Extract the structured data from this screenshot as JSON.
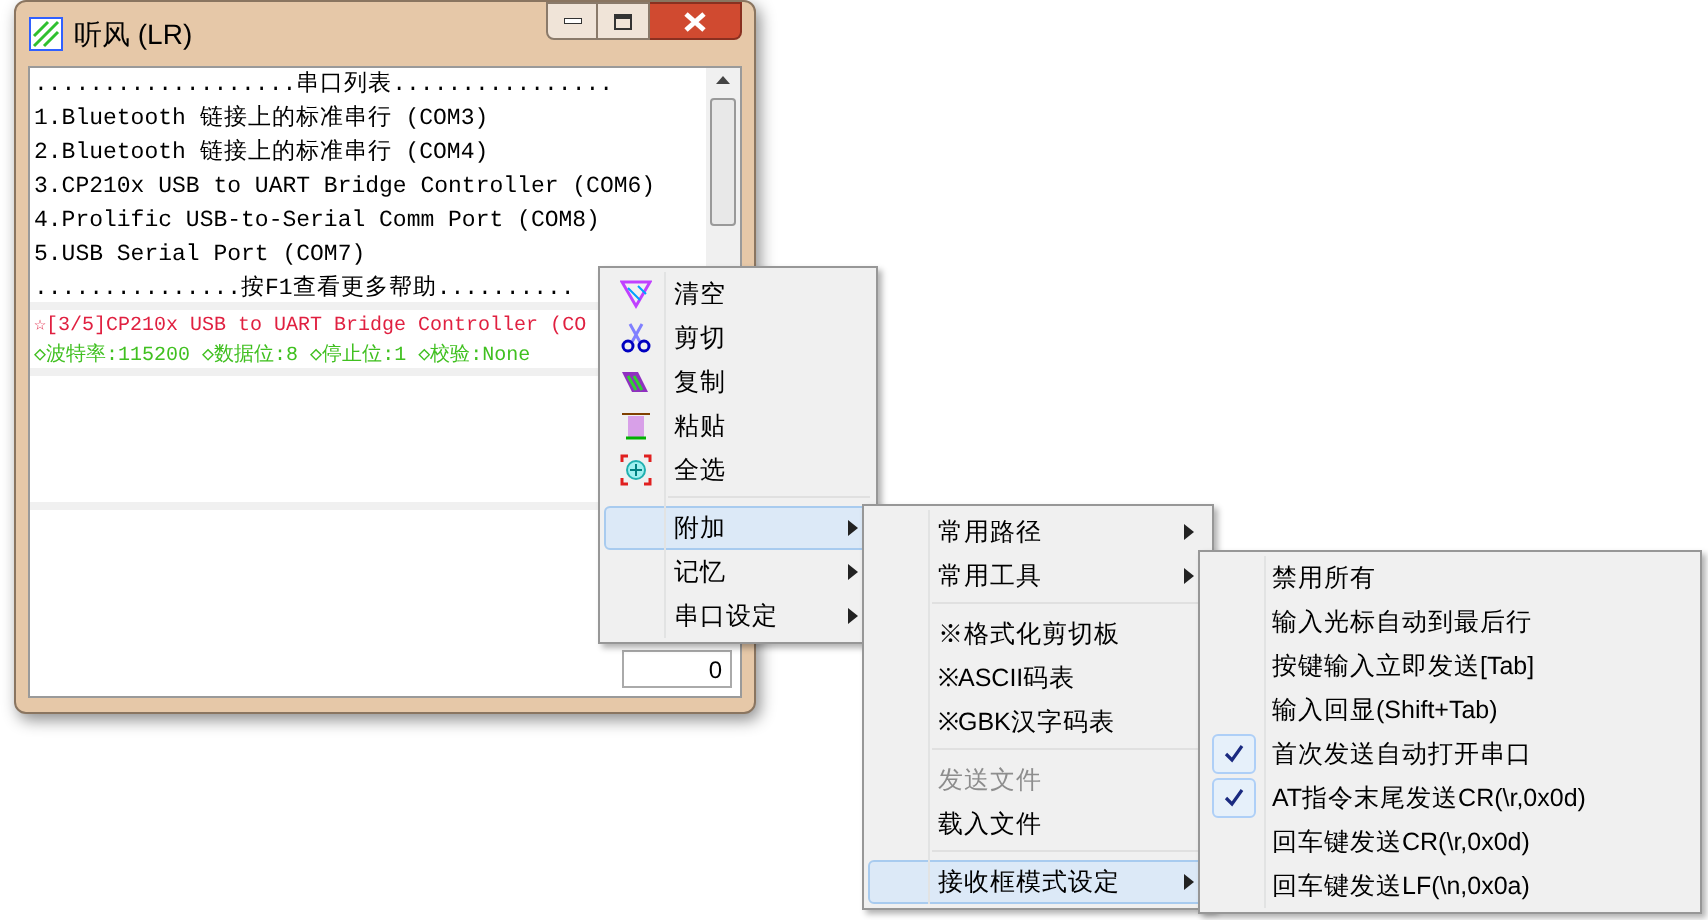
{
  "window": {
    "title": "听风 (LR)"
  },
  "port_list": {
    "header": "...................串口列表................",
    "lines": [
      "1.Bluetooth 链接上的标准串行 (COM3)",
      "2.Bluetooth 链接上的标准串行 (COM4)",
      "3.CP210x USB to UART Bridge Controller (COM6)",
      "4.Prolific USB-to-Serial Comm Port (COM8)",
      "5.USB Serial Port (COM7)"
    ],
    "footer": "...............按F1查看更多帮助.........."
  },
  "status": {
    "port": "☆[3/5]CP210x USB to UART Bridge Controller (CO",
    "settings": "◇波特率:115200 ◇数据位:8 ◇停止位:1 ◇校验:None"
  },
  "counter": {
    "value": "0"
  },
  "context_menu": [
    {
      "label": "清空",
      "selected": false,
      "submenu": false
    },
    {
      "label": "剪切",
      "selected": false,
      "submenu": false
    },
    {
      "label": "复制",
      "selected": false,
      "submenu": false
    },
    {
      "label": "粘贴",
      "selected": false,
      "submenu": false
    },
    {
      "label": "全选",
      "selected": false,
      "submenu": false,
      "separator_after": true
    },
    {
      "label": "附加",
      "selected": true,
      "submenu": true
    },
    {
      "label": "记忆",
      "selected": false,
      "submenu": true
    },
    {
      "label": "串口设定",
      "selected": false,
      "submenu": true
    }
  ],
  "extra_menu": [
    {
      "label": "常用路径",
      "selected": false,
      "submenu": true,
      "disabled": false
    },
    {
      "label": "常用工具",
      "selected": false,
      "submenu": true,
      "disabled": false,
      "separator_after": true
    },
    {
      "label": "※格式化剪切板",
      "selected": false,
      "submenu": false,
      "disabled": false
    },
    {
      "label": "※ASCII码表",
      "selected": false,
      "submenu": false,
      "disabled": false
    },
    {
      "label": "※GBK汉字码表",
      "selected": false,
      "submenu": false,
      "disabled": false,
      "separator_after": true
    },
    {
      "label": "发送文件",
      "selected": false,
      "submenu": false,
      "disabled": true
    },
    {
      "label": "载入文件",
      "selected": false,
      "submenu": false,
      "disabled": false,
      "separator_after": true
    },
    {
      "label": "接收框模式设定",
      "selected": true,
      "submenu": true,
      "disabled": false
    }
  ],
  "mode_menu": [
    {
      "label": "禁用所有",
      "checked": false
    },
    {
      "label": "输入光标自动到最后行",
      "checked": false
    },
    {
      "label": "按键输入立即发送[Tab]",
      "checked": false
    },
    {
      "label": "输入回显(Shift+Tab)",
      "checked": false
    },
    {
      "label": "首次发送自动打开串口",
      "checked": true
    },
    {
      "label": "AT指令末尾发送CR(\\r,0x0d)",
      "checked": true
    },
    {
      "label": "回车键发送CR(\\r,0x0d)",
      "checked": false
    },
    {
      "label": "回车键发送LF(\\n,0x0a)",
      "checked": false
    }
  ]
}
